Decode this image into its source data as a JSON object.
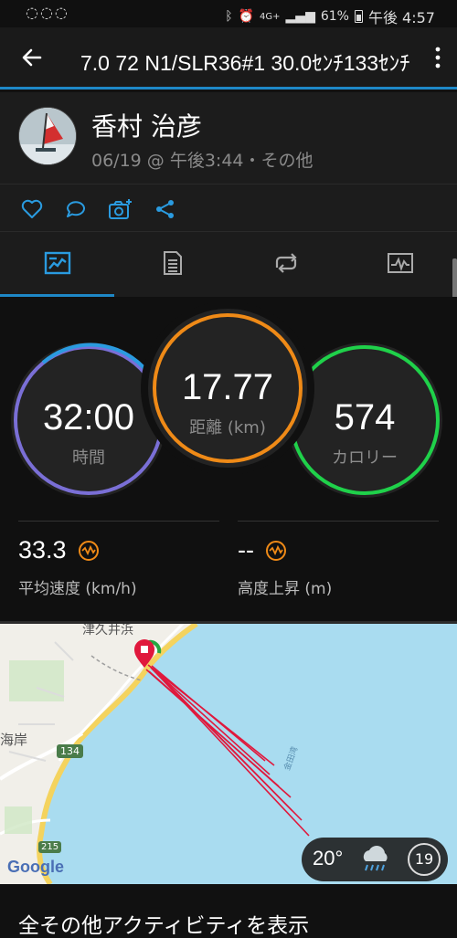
{
  "status_bar": {
    "battery": "61%",
    "time": "午後 4:57",
    "network": "4G+"
  },
  "app_bar": {
    "title": "7.0 72 N1/SLR36#1 30.0ｾﾝﾁ133ｾﾝﾁ"
  },
  "activity": {
    "user_name": "香村 治彦",
    "meta": "06/19 @ 午後3:44・その他"
  },
  "tabs": [
    {
      "name": "overview",
      "icon": "summary-icon",
      "active": true
    },
    {
      "name": "details",
      "icon": "list-icon",
      "active": false
    },
    {
      "name": "laps",
      "icon": "laps-icon",
      "active": false
    },
    {
      "name": "graphs",
      "icon": "chart-icon",
      "active": false
    }
  ],
  "stats": {
    "time": {
      "value": "32:00",
      "label": "時間",
      "color": "#7a6fd6"
    },
    "distance": {
      "value": "17.77",
      "label": "距離 (km)",
      "color": "#ef8a17"
    },
    "calories": {
      "value": "574",
      "label": "カロリー",
      "color": "#1fd14a"
    }
  },
  "metrics": {
    "avg_speed": {
      "value": "33.3",
      "label": "平均速度 (km/h)"
    },
    "elev_gain": {
      "value": "--",
      "label": "高度上昇 (m)"
    }
  },
  "map": {
    "labels": {
      "station": "津久井浜",
      "coast": "海岸",
      "route_134": "134",
      "route_215": "215",
      "google": "Google"
    },
    "weather": {
      "temp": "20°",
      "wind": "19"
    }
  },
  "footer": {
    "show_all": "全その他アクティビティを表示"
  },
  "colors": {
    "accent": "#1e88c7",
    "track": "#e0183c",
    "sea": "#a9dcf0"
  }
}
